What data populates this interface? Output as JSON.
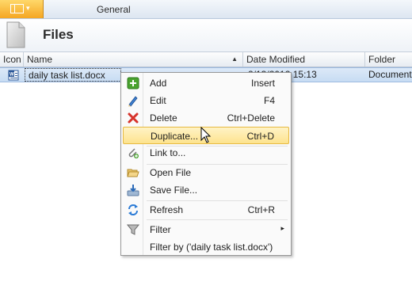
{
  "window": {
    "app_button": {
      "caret": "▾"
    },
    "tabs": [
      "General"
    ],
    "faded_tabs": [
      "",
      "",
      ""
    ]
  },
  "header": {
    "title": "Files",
    "icon": "file-icon"
  },
  "grid": {
    "columns": [
      {
        "label": "Icon"
      },
      {
        "label": "Name",
        "sort": "▲"
      },
      {
        "label": "Date Modified"
      },
      {
        "label": "Folder"
      }
    ],
    "rows": [
      {
        "icon": "word-document-icon",
        "name": "daily task list.docx",
        "date": "2/13/2012 15:13",
        "folder": "Documents"
      }
    ]
  },
  "context_menu": {
    "items": [
      {
        "label": "Add",
        "shortcut": "Insert",
        "icon": "add-icon"
      },
      {
        "label": "Edit",
        "shortcut": "F4",
        "icon": "edit-icon"
      },
      {
        "label": "Delete",
        "shortcut": "Ctrl+Delete",
        "icon": "delete-icon"
      },
      {
        "label": "Duplicate...",
        "shortcut": "Ctrl+D",
        "icon": "",
        "selected": true
      },
      {
        "label": "Link to...",
        "shortcut": "",
        "icon": "paperclip-icon"
      },
      {
        "label": "Open File",
        "shortcut": "",
        "icon": "open-folder-icon"
      },
      {
        "label": "Save File...",
        "shortcut": "",
        "icon": "save-file-icon"
      },
      {
        "label": "Refresh",
        "shortcut": "Ctrl+R",
        "icon": "refresh-icon"
      },
      {
        "label": "Filter",
        "shortcut": "",
        "icon": "filter-icon",
        "submenu": "▸"
      },
      {
        "label": "Filter by ('daily task list.docx')",
        "shortcut": "",
        "icon": ""
      }
    ]
  },
  "colors": {
    "selection_row": "#c7dcf3",
    "menu_highlight": "#fde38e",
    "app_button": "#f5a622"
  }
}
